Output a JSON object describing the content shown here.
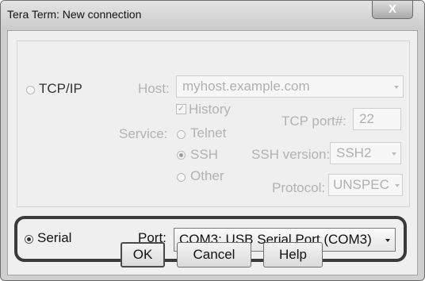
{
  "window": {
    "title": "Tera Term: New connection",
    "close_glyph": "X"
  },
  "tcpip": {
    "label": "TCP/IP",
    "selected": false,
    "host_label": "Host:",
    "host_value": "myhost.example.com",
    "history_label": "History",
    "history_checked": true,
    "service_label": "Service:",
    "services": [
      {
        "label": "Telnet",
        "selected": false
      },
      {
        "label": "SSH",
        "selected": true
      },
      {
        "label": "Other",
        "selected": false
      }
    ],
    "tcp_port_label": "TCP port#:",
    "tcp_port_value": "22",
    "ssh_version_label": "SSH version:",
    "ssh_version_value": "SSH2",
    "protocol_label": "Protocol:",
    "protocol_value": "UNSPEC"
  },
  "serial": {
    "label": "Serial",
    "selected": true,
    "port_label": "Port:",
    "port_value": "COM3: USB Serial Port (COM3)"
  },
  "buttons": {
    "ok": "OK",
    "cancel": "Cancel",
    "help": "Help"
  },
  "icons": {
    "history_check": "checkmark-icon",
    "dropdown": "chevron-down-icon",
    "close": "close-icon"
  },
  "colors": {
    "highlight_border": "#3a3a3a",
    "disabled_text": "#b2b2b2"
  }
}
